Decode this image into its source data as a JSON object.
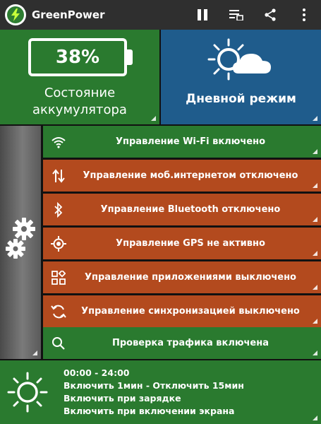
{
  "app": {
    "title": "GreenPower"
  },
  "battery": {
    "percent": "38%",
    "label_line1": "Состояние",
    "label_line2": "аккумулятора"
  },
  "mode": {
    "label": "Дневной режим"
  },
  "controls": [
    {
      "label": "Управление Wi-Fi включено",
      "state": "on",
      "icon": "wifi-icon"
    },
    {
      "label": "Управление моб.интернетом отключено",
      "state": "off",
      "icon": "mobile-data-icon"
    },
    {
      "label": "Управление Bluetooth отключено",
      "state": "off",
      "icon": "bluetooth-icon"
    },
    {
      "label": "Управление GPS не активно",
      "state": "off",
      "icon": "gps-icon"
    },
    {
      "label": "Управление приложениями выключено",
      "state": "off",
      "icon": "apps-icon"
    },
    {
      "label": "Управление синхронизацией выключено",
      "state": "off",
      "icon": "sync-icon"
    },
    {
      "label": "Проверка трафика включена",
      "state": "on",
      "icon": "search-icon"
    }
  ],
  "schedule": {
    "time_range": "00:00 - 24:00",
    "cycle": "Включить 1мин - Отключить 15мин",
    "on_charging": "Включить при зарядке",
    "on_screen": "Включить при включении экрана"
  },
  "colors": {
    "enabled": "#2a7a2f",
    "disabled": "#b34a1e",
    "mode_tile": "#1f5c8c",
    "appbar": "#2f2f2f"
  }
}
